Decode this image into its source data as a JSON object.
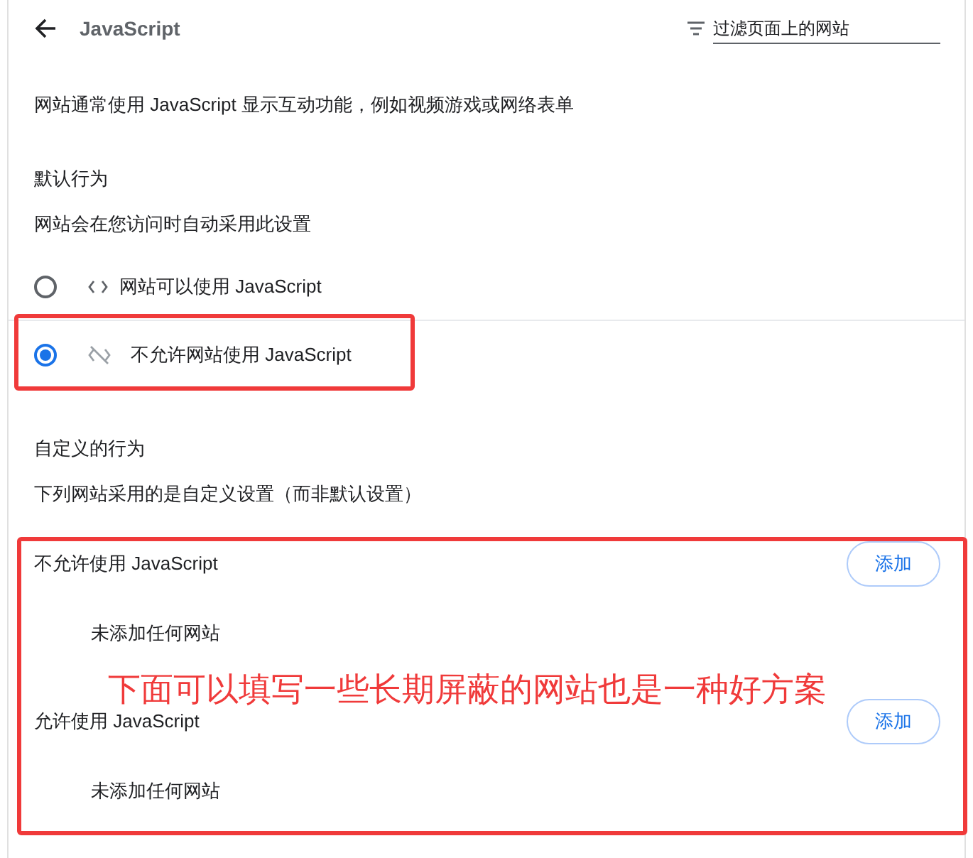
{
  "header": {
    "title": "JavaScript",
    "filter": {
      "placeholder": "过滤页面上的网站"
    }
  },
  "description": "网站通常使用 JavaScript 显示互动功能，例如视频游戏或网络表单",
  "default_behavior": {
    "heading": "默认行为",
    "subtitle": "网站会在您访问时自动采用此设置",
    "options": [
      {
        "kind": "allow",
        "label": "网站可以使用 JavaScript",
        "selected": false
      },
      {
        "kind": "block",
        "label": "不允许网站使用 JavaScript",
        "selected": true
      }
    ]
  },
  "custom_behavior": {
    "heading": "自定义的行为",
    "subtitle": "下列网站采用的是自定义设置（而非默认设置）",
    "sections": [
      {
        "title": "不允许使用 JavaScript",
        "button": "添加",
        "empty": "未添加任何网站"
      },
      {
        "title": "允许使用 JavaScript",
        "button": "添加",
        "empty": "未添加任何网站"
      }
    ]
  },
  "annotation": "下面可以填写一些长期屏蔽的网站也是一种好方案"
}
